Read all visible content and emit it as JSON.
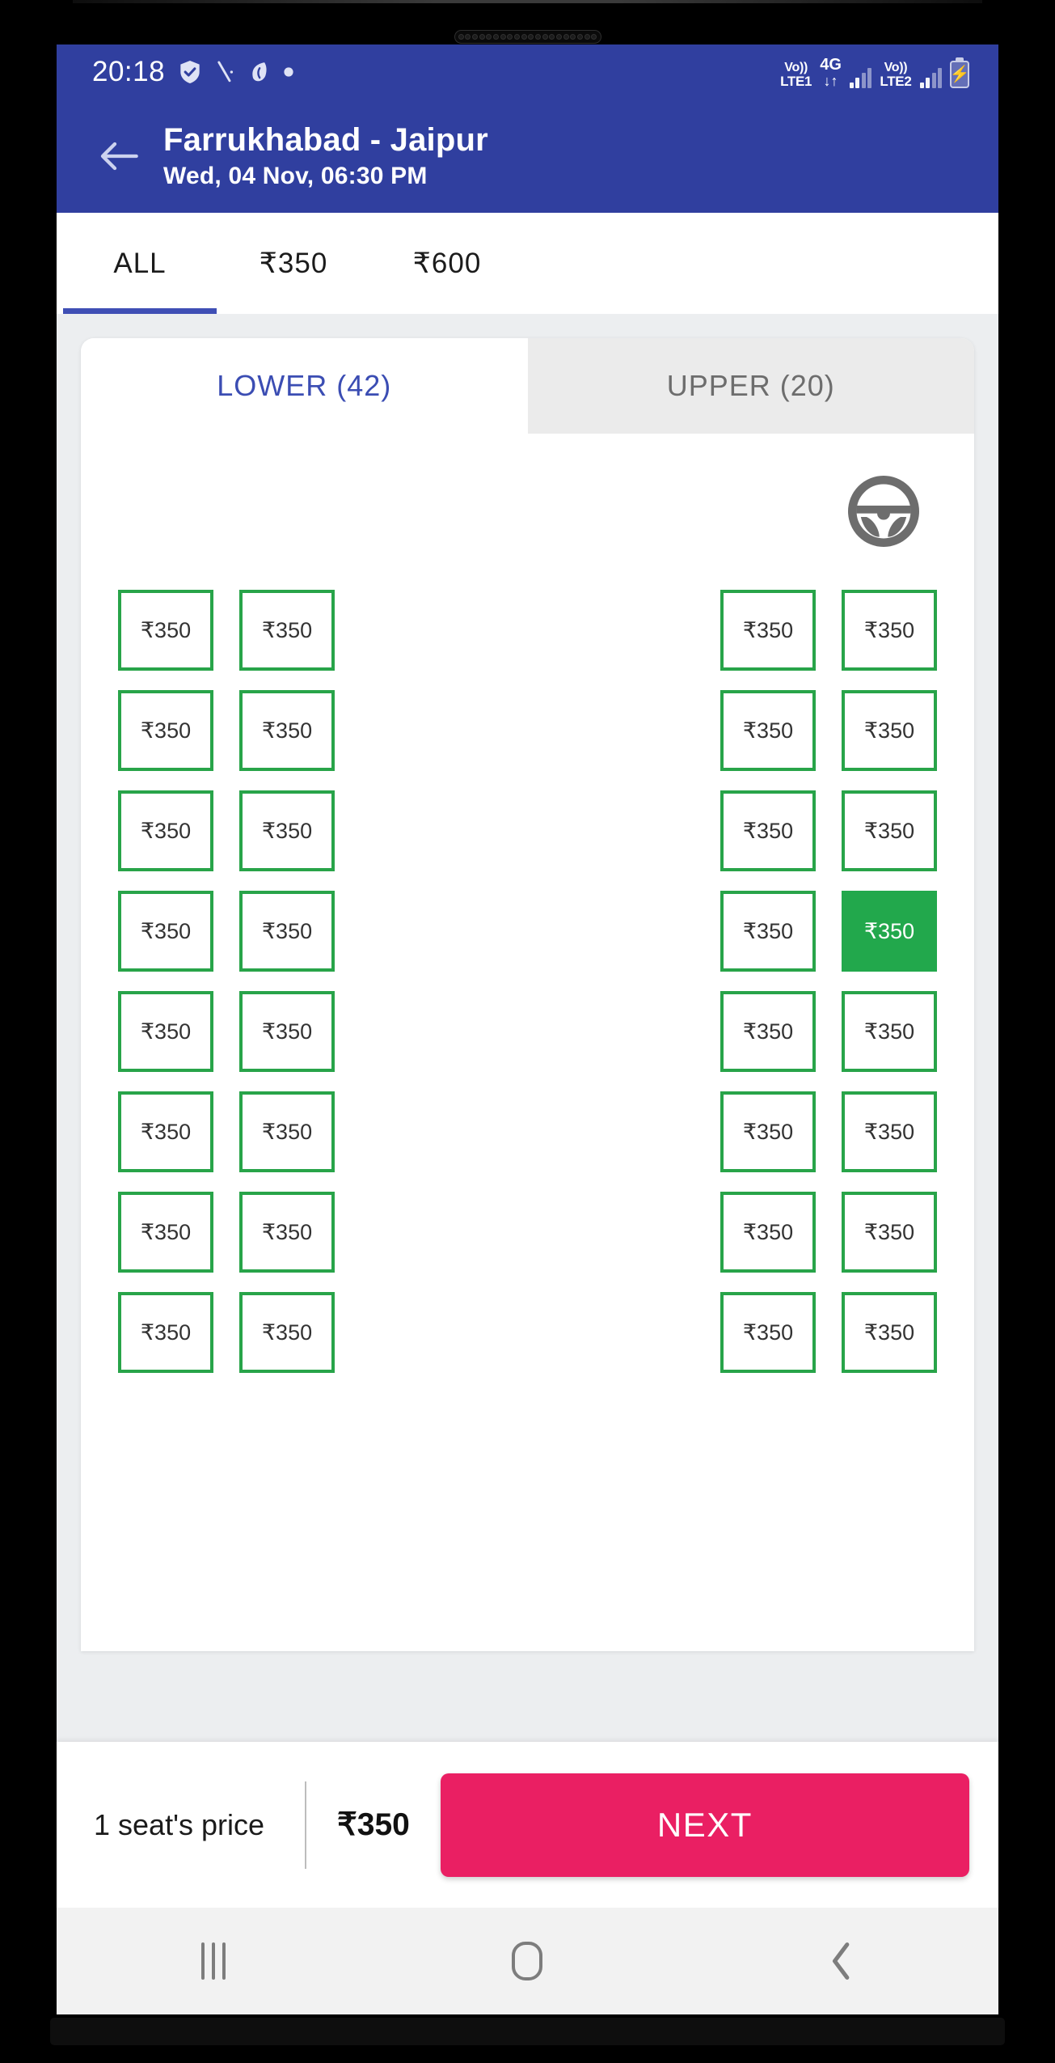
{
  "status_bar": {
    "time": "20:18",
    "left_icons": [
      "shield-check-icon",
      "pen-slash-icon",
      "leaf-app-icon",
      "dot-icon"
    ],
    "sim1_volte_line1": "Vo))",
    "sim1_volte_line2": "LTE1",
    "network_type": "4G",
    "network_arrows": "↓↑",
    "sim2_volte_line1": "Vo))",
    "sim2_volte_line2": "LTE2",
    "battery_icon": "battery-charging-icon"
  },
  "app_bar": {
    "back_icon": "back-arrow-icon",
    "route_title": "Farrukhabad - Jaipur",
    "journey_datetime": "Wed, 04 Nov,  06:30 PM",
    "background_color": "#303f9f"
  },
  "fare_tabs": [
    {
      "label": "ALL",
      "active": true
    },
    {
      "label": "₹350",
      "active": false
    },
    {
      "label": "₹600",
      "active": false
    }
  ],
  "deck_tabs": [
    {
      "label": "LOWER (42)",
      "active": true
    },
    {
      "label": "UPPER (20)",
      "active": false
    }
  ],
  "deck": {
    "driver_icon": "steering-wheel-icon",
    "seat_fare": "₹350",
    "selected_seat": {
      "row": 4,
      "side": "right",
      "column": 2
    },
    "rows": 8,
    "seats_per_side": 2,
    "colors": {
      "available_border": "#28a449",
      "selected_fill": "#22a84c",
      "accent_blue": "#3b4db3",
      "action_pink": "#ea1f63"
    }
  },
  "bottom_bar": {
    "seat_count_label": "1 seat's price",
    "total_price": "₹350",
    "next_label": "NEXT"
  },
  "nav_bar": {
    "recents_icon": "recents-icon",
    "home_icon": "home-icon",
    "back_icon": "back-chevron-icon"
  }
}
